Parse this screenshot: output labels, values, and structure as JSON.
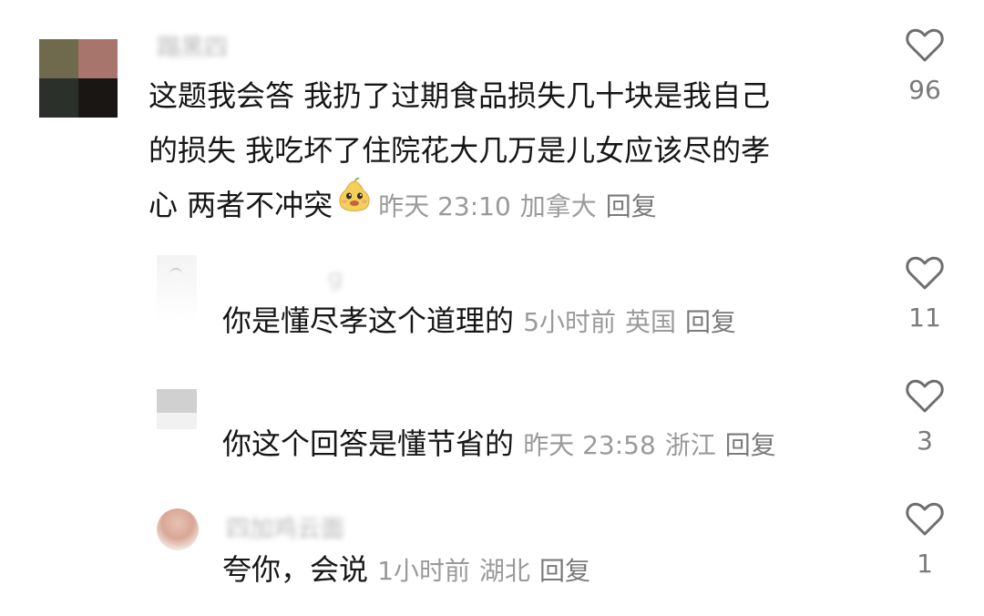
{
  "comments": [
    {
      "username": "蹋黑四",
      "text": "这题我会答 我扔了过期食品损失几十块是我自己的损失 我吃坏了住院花大几万是儿女应该尽的孝心 两者不冲突",
      "text_lines": [
        "这题我会答 我扔了过期食品损失几十块是我自己",
        "的损失 我吃坏了住院花大几万是儿女应该尽的孝",
        "心 两者不冲突"
      ],
      "time": "昨天 23:10",
      "location": "加拿大",
      "reply": "回复",
      "likes": "96",
      "emoji": "pear-face-emoji"
    },
    {
      "username": "g",
      "text": "你是懂尽孝这个道理的",
      "time": "5小时前",
      "location": "英国",
      "reply": "回复",
      "likes": "11"
    },
    {
      "username": "",
      "text": "你这个回答是懂节省的",
      "time": "昨天 23:58",
      "location": "浙江",
      "reply": "回复",
      "likes": "3"
    },
    {
      "username": "四加鸡云面",
      "text": "夸你，会说",
      "time": "1小时前",
      "location": "湖北",
      "reply": "回复",
      "likes": "1"
    }
  ],
  "icons": {
    "like": "heart-outline-icon"
  },
  "colors": {
    "text": "#161616",
    "meta": "#9a9a9a",
    "heart": "#7a7a7a"
  }
}
